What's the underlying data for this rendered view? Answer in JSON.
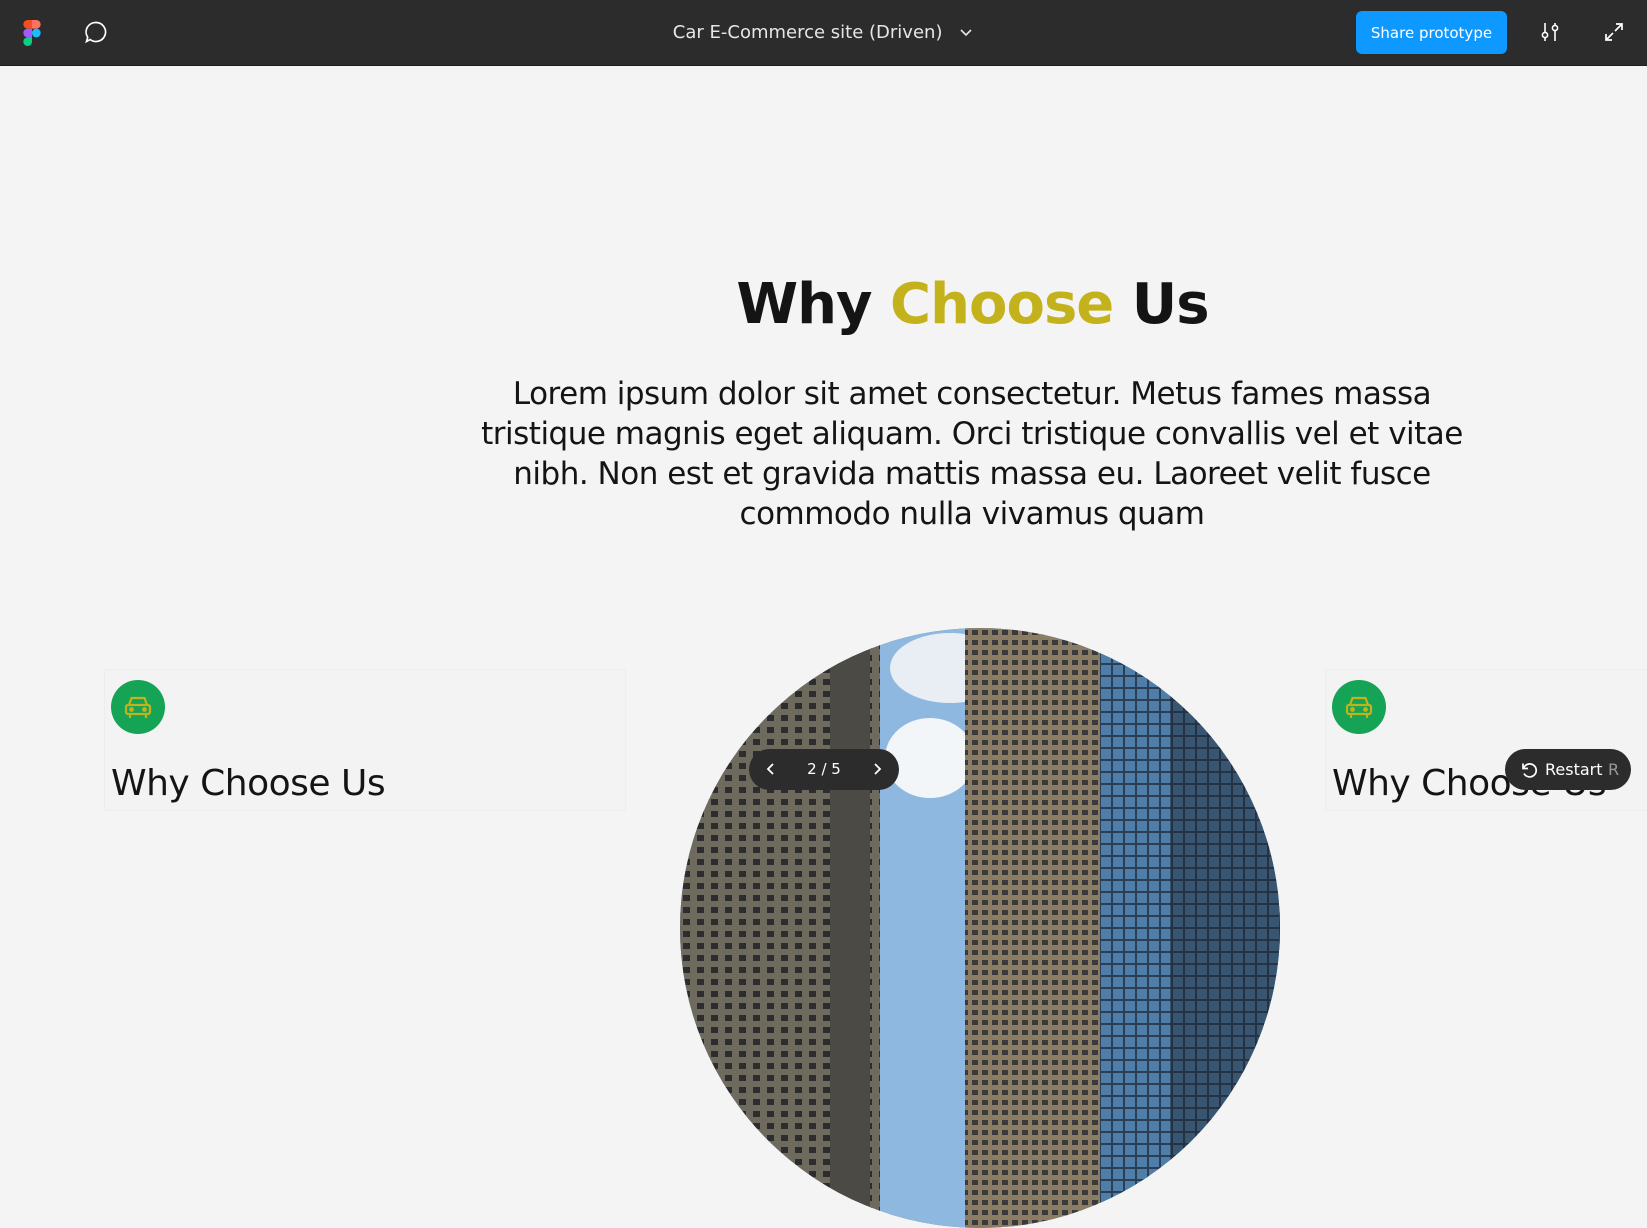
{
  "app": {
    "file_title": "Car E-Commerce site (Driven)",
    "share_label": "Share prototype",
    "colors": {
      "toolbar": "#2c2c2c",
      "share": "#0d99ff",
      "accent": "#c3b21c",
      "badge": "#15a356"
    },
    "icons": [
      "figma-logo",
      "comment-icon",
      "chevron-down-icon",
      "settings-sliders-icon",
      "expand-icon"
    ]
  },
  "hero": {
    "heading_part1": "Why ",
    "heading_accent": "Choose",
    "heading_part2": " Us",
    "intro": "Lorem ipsum dolor sit amet consectetur. Metus fames massa tristique magnis eget aliquam. Orci tristique convallis vel et vitae nibh. Non est et gravida mattis massa eu. Laoreet velit fusce commodo nulla vivamus quam"
  },
  "cards": [
    {
      "icon": "car-icon",
      "title": "Why Choose Us"
    },
    {
      "icon": "car-icon",
      "title": "Why Choose Us"
    }
  ],
  "pager": {
    "count": "2 / 5"
  },
  "restart": {
    "label": "Restart",
    "shortcut": "R"
  }
}
